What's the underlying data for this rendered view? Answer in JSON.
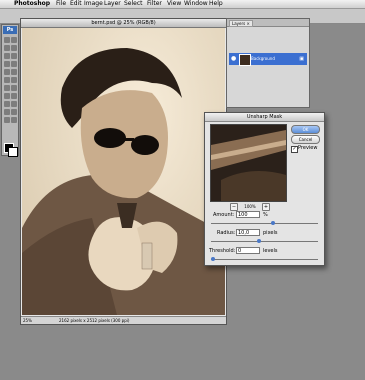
{
  "menubar": {
    "apple_glyph": "",
    "app_name": "Photoshop",
    "items": [
      "File",
      "Edit",
      "Image",
      "Layer",
      "Select",
      "Filter",
      "View",
      "Window",
      "Help"
    ]
  },
  "toolbox": {
    "logo": "Ps",
    "foreground_color": "#000000",
    "background_color": "#ffffff"
  },
  "document": {
    "title": "bernt.psd @ 25% (RGB/8)",
    "zoom": "25%",
    "doc_info": "2162 pixels x 2512 pixels (300 ppi)"
  },
  "layers_panel": {
    "tab_label": "Layers ×",
    "layer_name": "Background",
    "visible_icon": "eye-icon",
    "lock_icon": "lock-icon"
  },
  "unsharp_mask": {
    "title": "Unsharp Mask",
    "ok_label": "OK",
    "cancel_label": "Cancel",
    "preview_label": "Preview",
    "preview_checked": true,
    "preview_zoom": "100%",
    "zoom_out_glyph": "−",
    "zoom_in_glyph": "+",
    "amount_label": "Amount:",
    "amount_value": "100",
    "amount_unit": "%",
    "radius_label": "Radius:",
    "radius_value": "10,0",
    "radius_unit": "pixels",
    "threshold_label": "Threshold:",
    "threshold_value": "0",
    "threshold_unit": "levels",
    "accent_color": "#5d8fd8"
  }
}
